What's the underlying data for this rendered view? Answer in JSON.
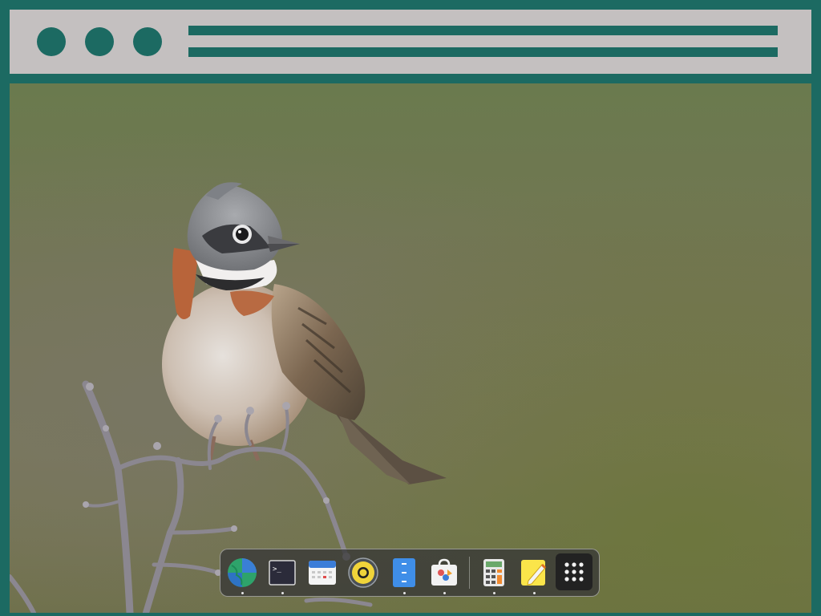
{
  "window": {
    "header_dots": [
      "dot-1",
      "dot-2",
      "dot-3"
    ]
  },
  "wallpaper": {
    "subject": "bird-on-branch"
  },
  "dock": {
    "items": [
      {
        "icon": "globe-icon",
        "running": true
      },
      {
        "icon": "terminal-icon",
        "running": true
      },
      {
        "icon": "calendar-icon",
        "running": false
      },
      {
        "icon": "music-icon",
        "running": false
      },
      {
        "icon": "document-icon",
        "running": true
      },
      {
        "icon": "store-icon",
        "running": true
      },
      {
        "icon": "calculator-icon",
        "running": true
      },
      {
        "icon": "notes-icon",
        "running": true
      },
      {
        "icon": "app-grid-icon",
        "running": false
      }
    ],
    "terminal_prompt": ">_"
  },
  "colors": {
    "frame": "#1c6a62",
    "header": "#c4c0c0",
    "dock_bg": "#373737"
  }
}
